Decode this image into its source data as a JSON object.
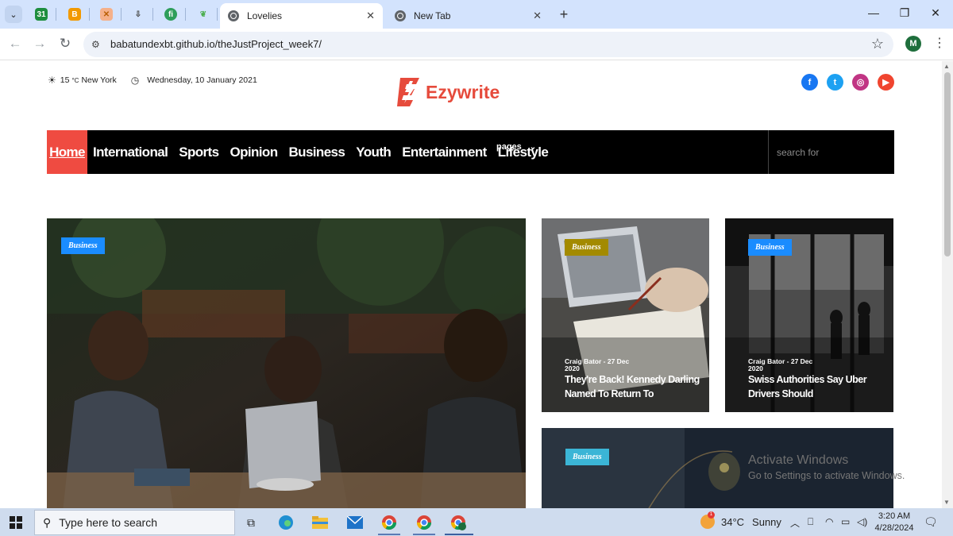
{
  "browser": {
    "tabs": [
      {
        "title": "Lovelies",
        "active": true
      },
      {
        "title": "New Tab",
        "active": false
      }
    ],
    "pinned_icons": [
      "cal-icon",
      "blogger-icon",
      "layers-icon",
      "filter-icon",
      "fi-icon",
      "leaf-icon"
    ],
    "url": "babatundexbt.github.io/theJustProject_week7/",
    "profile_initial": "M"
  },
  "site": {
    "weather_temp": "15",
    "weather_unit": "°C",
    "weather_city": "New York",
    "date": "Wednesday, 10 January 2021",
    "logo_text": "Ezywrite",
    "nav": {
      "home": "Home",
      "items": [
        "International",
        "Sports",
        "Opinion",
        "Business",
        "Youth",
        "Entertainment",
        "Lifestyle"
      ],
      "pages": "pages",
      "search_placeholder": "search for"
    },
    "cards": {
      "hero": {
        "badge": "Business",
        "badge_color": "#1a8cff"
      },
      "card1": {
        "badge": "Business",
        "badge_color": "#a38a00",
        "meta": "Craig Bator - 27 Dec 2020",
        "title": "They're Back! Kennedy Darling Named To Return To"
      },
      "card2": {
        "badge": "Business",
        "badge_color": "#1a8cff",
        "meta": "Craig Bator - 27 Dec 2020",
        "title": "Swiss Authorities Say Uber Drivers Should"
      },
      "card3": {
        "badge": "Business",
        "badge_color": "#3bb5d6"
      }
    },
    "colors": {
      "accent": "#e64b3c",
      "nav_bg": "#000000",
      "home_bg": "#ef4b41"
    }
  },
  "watermark": {
    "line1": "Activate Windows",
    "line2": "Go to Settings to activate Windows."
  },
  "taskbar": {
    "search_placeholder": "Type here to search",
    "weather_temp": "34°C",
    "weather_desc": "Sunny",
    "weather_alert": "1",
    "time": "3:20 AM",
    "date": "4/28/2024"
  }
}
